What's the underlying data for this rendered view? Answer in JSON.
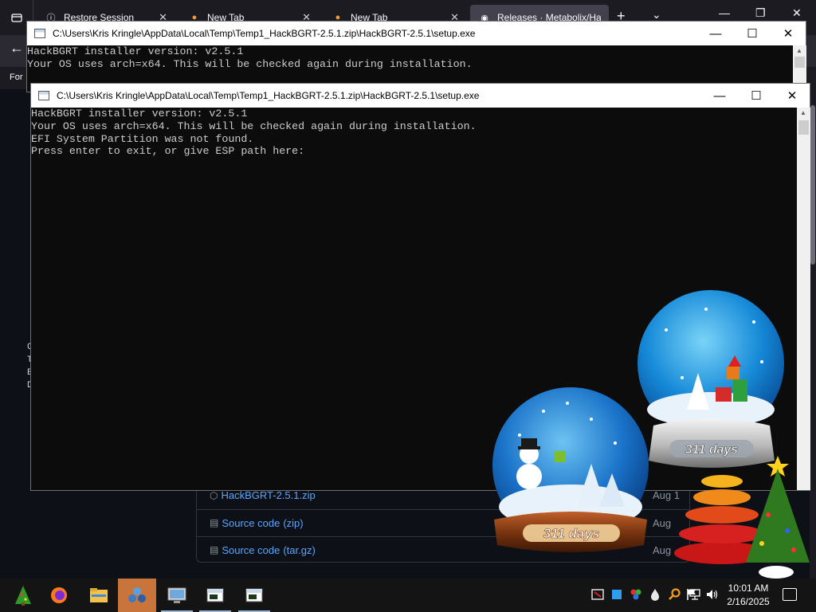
{
  "browser": {
    "sidebar_icon": "tab-overview-icon",
    "tabs": [
      {
        "title": "Restore Session",
        "icon": "info-icon"
      },
      {
        "title": "New Tab",
        "icon": "firefox-icon"
      },
      {
        "title": "New Tab",
        "icon": "firefox-icon"
      },
      {
        "title": "Releases · Metabolix/HackBGRT",
        "icon": "github-icon"
      }
    ],
    "back_icon": "back-arrow-icon",
    "bookmark_label": "For",
    "edge_chars": [
      "C",
      "T",
      "E",
      "D"
    ],
    "assets": [
      {
        "icon": "package-icon",
        "name": "HackBGRT-2.5.1.zip",
        "type": "",
        "date": "Aug 1"
      },
      {
        "icon": "file-zip-icon",
        "name": "Source code",
        "type": "(zip)",
        "date": "Aug"
      },
      {
        "icon": "file-zip-icon",
        "name": "Source code",
        "type": "(tar.gz)",
        "date": "Aug"
      }
    ]
  },
  "console_back": {
    "title": "C:\\Users\\Kris Kringle\\AppData\\Local\\Temp\\Temp1_HackBGRT-2.5.1.zip\\HackBGRT-2.5.1\\setup.exe",
    "lines": [
      "HackBGRT installer version: v2.5.1",
      "Your OS uses arch=x64. This will be checked again during installation."
    ]
  },
  "console_front": {
    "title": "C:\\Users\\Kris Kringle\\AppData\\Local\\Temp\\Temp1_HackBGRT-2.5.1.zip\\HackBGRT-2.5.1\\setup.exe",
    "lines": [
      "HackBGRT installer version: v2.5.1",
      "Your OS uses arch=x64. This will be checked again during installation.",
      "EFI System Partition was not found.",
      "Press enter to exit, or give ESP path here:"
    ]
  },
  "window_controls": {
    "minimize": "—",
    "maximize": "☐",
    "close": "✕"
  },
  "globes": {
    "left_label": "311 days",
    "right_label": "311 days"
  },
  "taskbar": {
    "apps": [
      "tree-start-icon",
      "firefox-icon",
      "file-explorer-icon",
      "app-icon",
      "remote-desktop-icon",
      "console-icon",
      "console-icon"
    ],
    "tray_icons": [
      "security-icon",
      "blue-square-icon",
      "network-app-icon",
      "drop-icon",
      "search-icon",
      "flag-icon",
      "network-icon",
      "volume-icon"
    ],
    "time": "10:01 AM",
    "date": "2/16/2025"
  },
  "colors": {
    "console_bg": "#0c0c0c",
    "console_text": "#cccccc",
    "github_link": "#58a6ff",
    "taskbar_active": "#c8743a"
  }
}
